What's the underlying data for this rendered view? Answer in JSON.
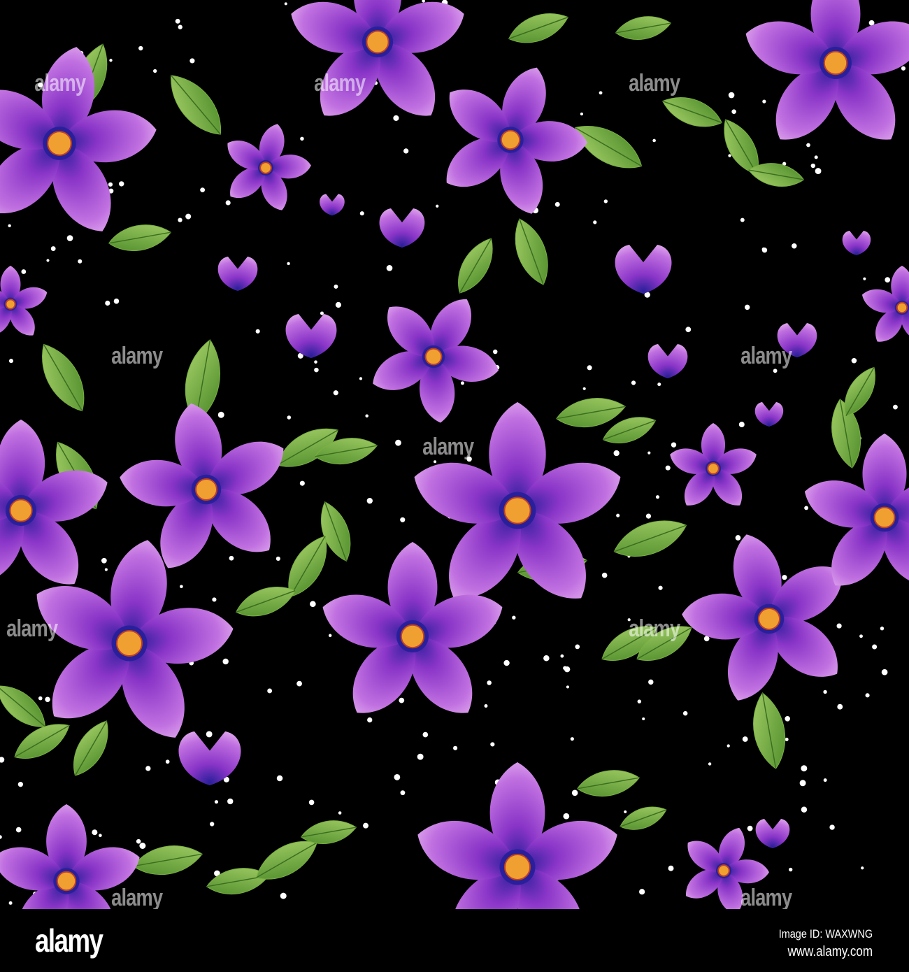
{
  "image": {
    "watermark": "alamy",
    "colors": {
      "background": "#000000",
      "petal": "#a040d0",
      "petal_light": "#d890e8",
      "center": "#2a1f9a",
      "stamen": "#f0a030",
      "leaf": "#5f9a2e",
      "leaf_light": "#9cc860",
      "dot": "#ffffff"
    }
  },
  "footer": {
    "logo": "alamy",
    "image_id": "Image ID: WAXWNG",
    "website": "www.alamy.com"
  }
}
